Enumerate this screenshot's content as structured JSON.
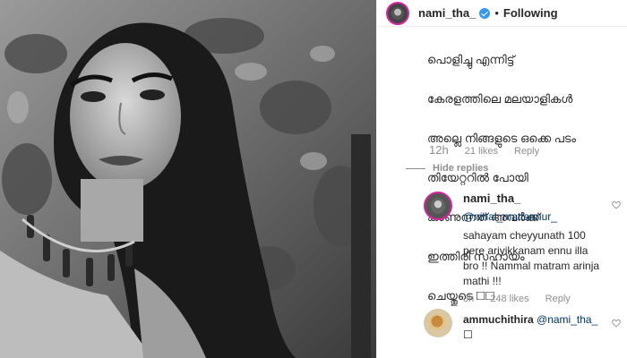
{
  "post": {
    "username": "nami_tha_",
    "separator": "•",
    "follow_status": "Following"
  },
  "comment": {
    "text_lines": [
      "പൊളിച്ചു എന്നിട്ട്",
      "കേരളത്തിലെ മലയാളികൾ",
      "അല്ലെ നിങ്ങളുടെ ഒക്കെ പടം",
      "തിയേറ്ററിൽ പോയി",
      "കാണുന്നത് അവർക്ക്",
      "ഇത്തിരി സഹായം",
      "ചെയ്തൂടെ ☐☐"
    ],
    "time": "12h",
    "likes": "21 likes",
    "reply_label": "Reply",
    "hide_replies": "Hide replies"
  },
  "replies": [
    {
      "username": "nami_tha_",
      "mention": "@nihal_mattannur_",
      "text": "sahayam cheyyunath 100 pere ariyikkanam ennu illa bro !! Nammal matram arinja mathi !!!",
      "time": "3h",
      "likes": "248 likes",
      "reply_label": "Reply"
    },
    {
      "username": "ammuchithira",
      "mention": "@nami_tha_",
      "text": "☐"
    }
  ]
}
